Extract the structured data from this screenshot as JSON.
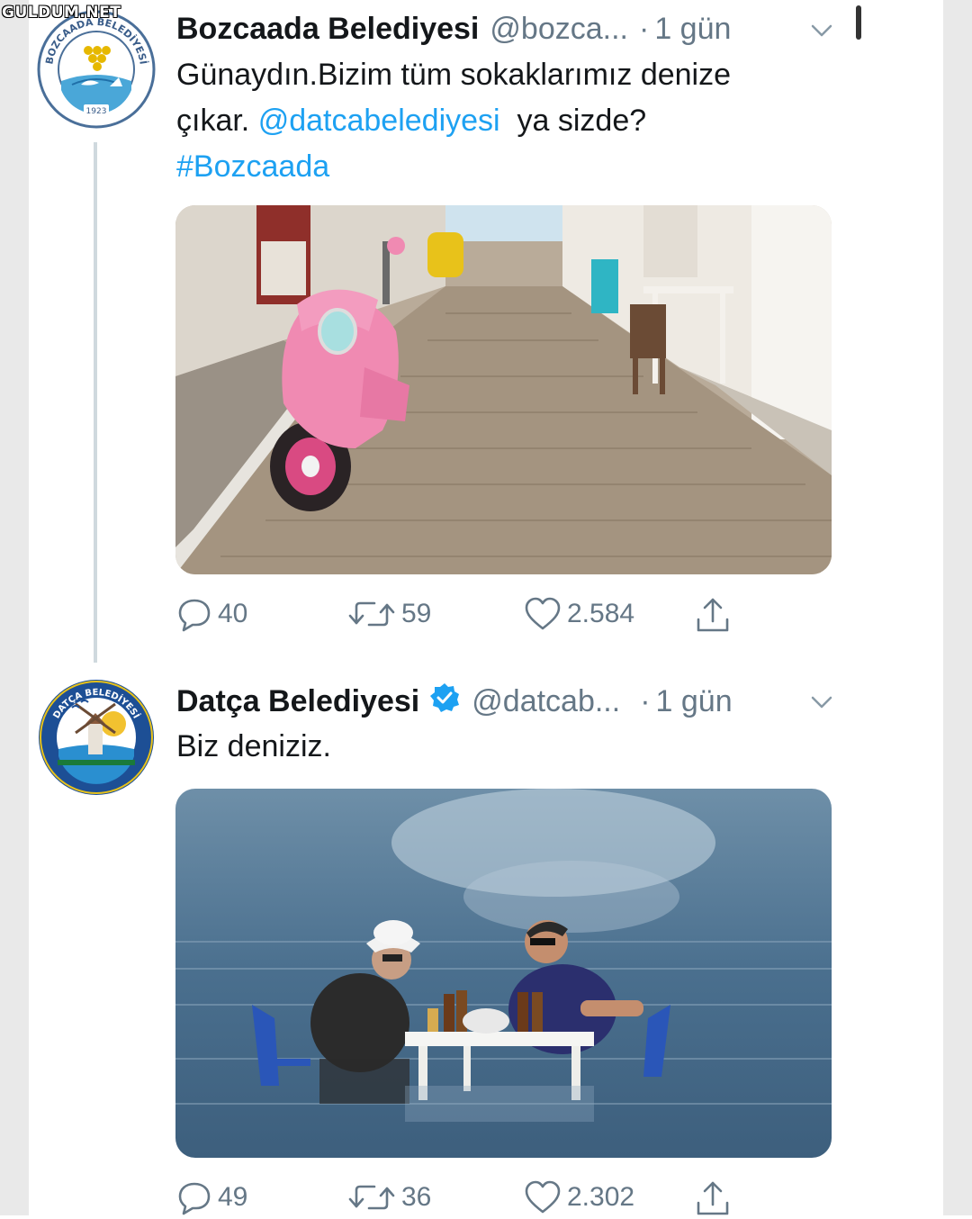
{
  "watermark": "GULDUM.NET",
  "tweets": [
    {
      "name": "Bozcaada Belediyesi",
      "handle": "@bozca...",
      "separator": "·",
      "time": "1 gün",
      "verified": false,
      "text_parts": [
        "Günaydın.Bizim tüm sokaklarımız denize",
        "çıkar. ",
        "@datcabelediyesi",
        "  ya sizde?",
        "#Bozcaada"
      ],
      "avatar_text_top": "BOZCAADA BELEDİYESİ",
      "avatar_year": "1923",
      "photo_icon": "pink-scooter-street-photo",
      "replies": "40",
      "retweets": "59",
      "likes": "2.584"
    },
    {
      "name": "Datça Belediyesi",
      "handle": "@datcab...",
      "separator": "·",
      "time": "1 gün",
      "verified": true,
      "text": "Biz deniziz.",
      "avatar_text_top": "DATÇA BELEDİYESİ",
      "photo_icon": "table-in-sea-photo",
      "replies": "49",
      "retweets": "36",
      "likes": "2.302"
    }
  ],
  "colors": {
    "accent": "#1da1f2",
    "secondary_text": "#657786",
    "thread_line": "#cfd9de"
  }
}
